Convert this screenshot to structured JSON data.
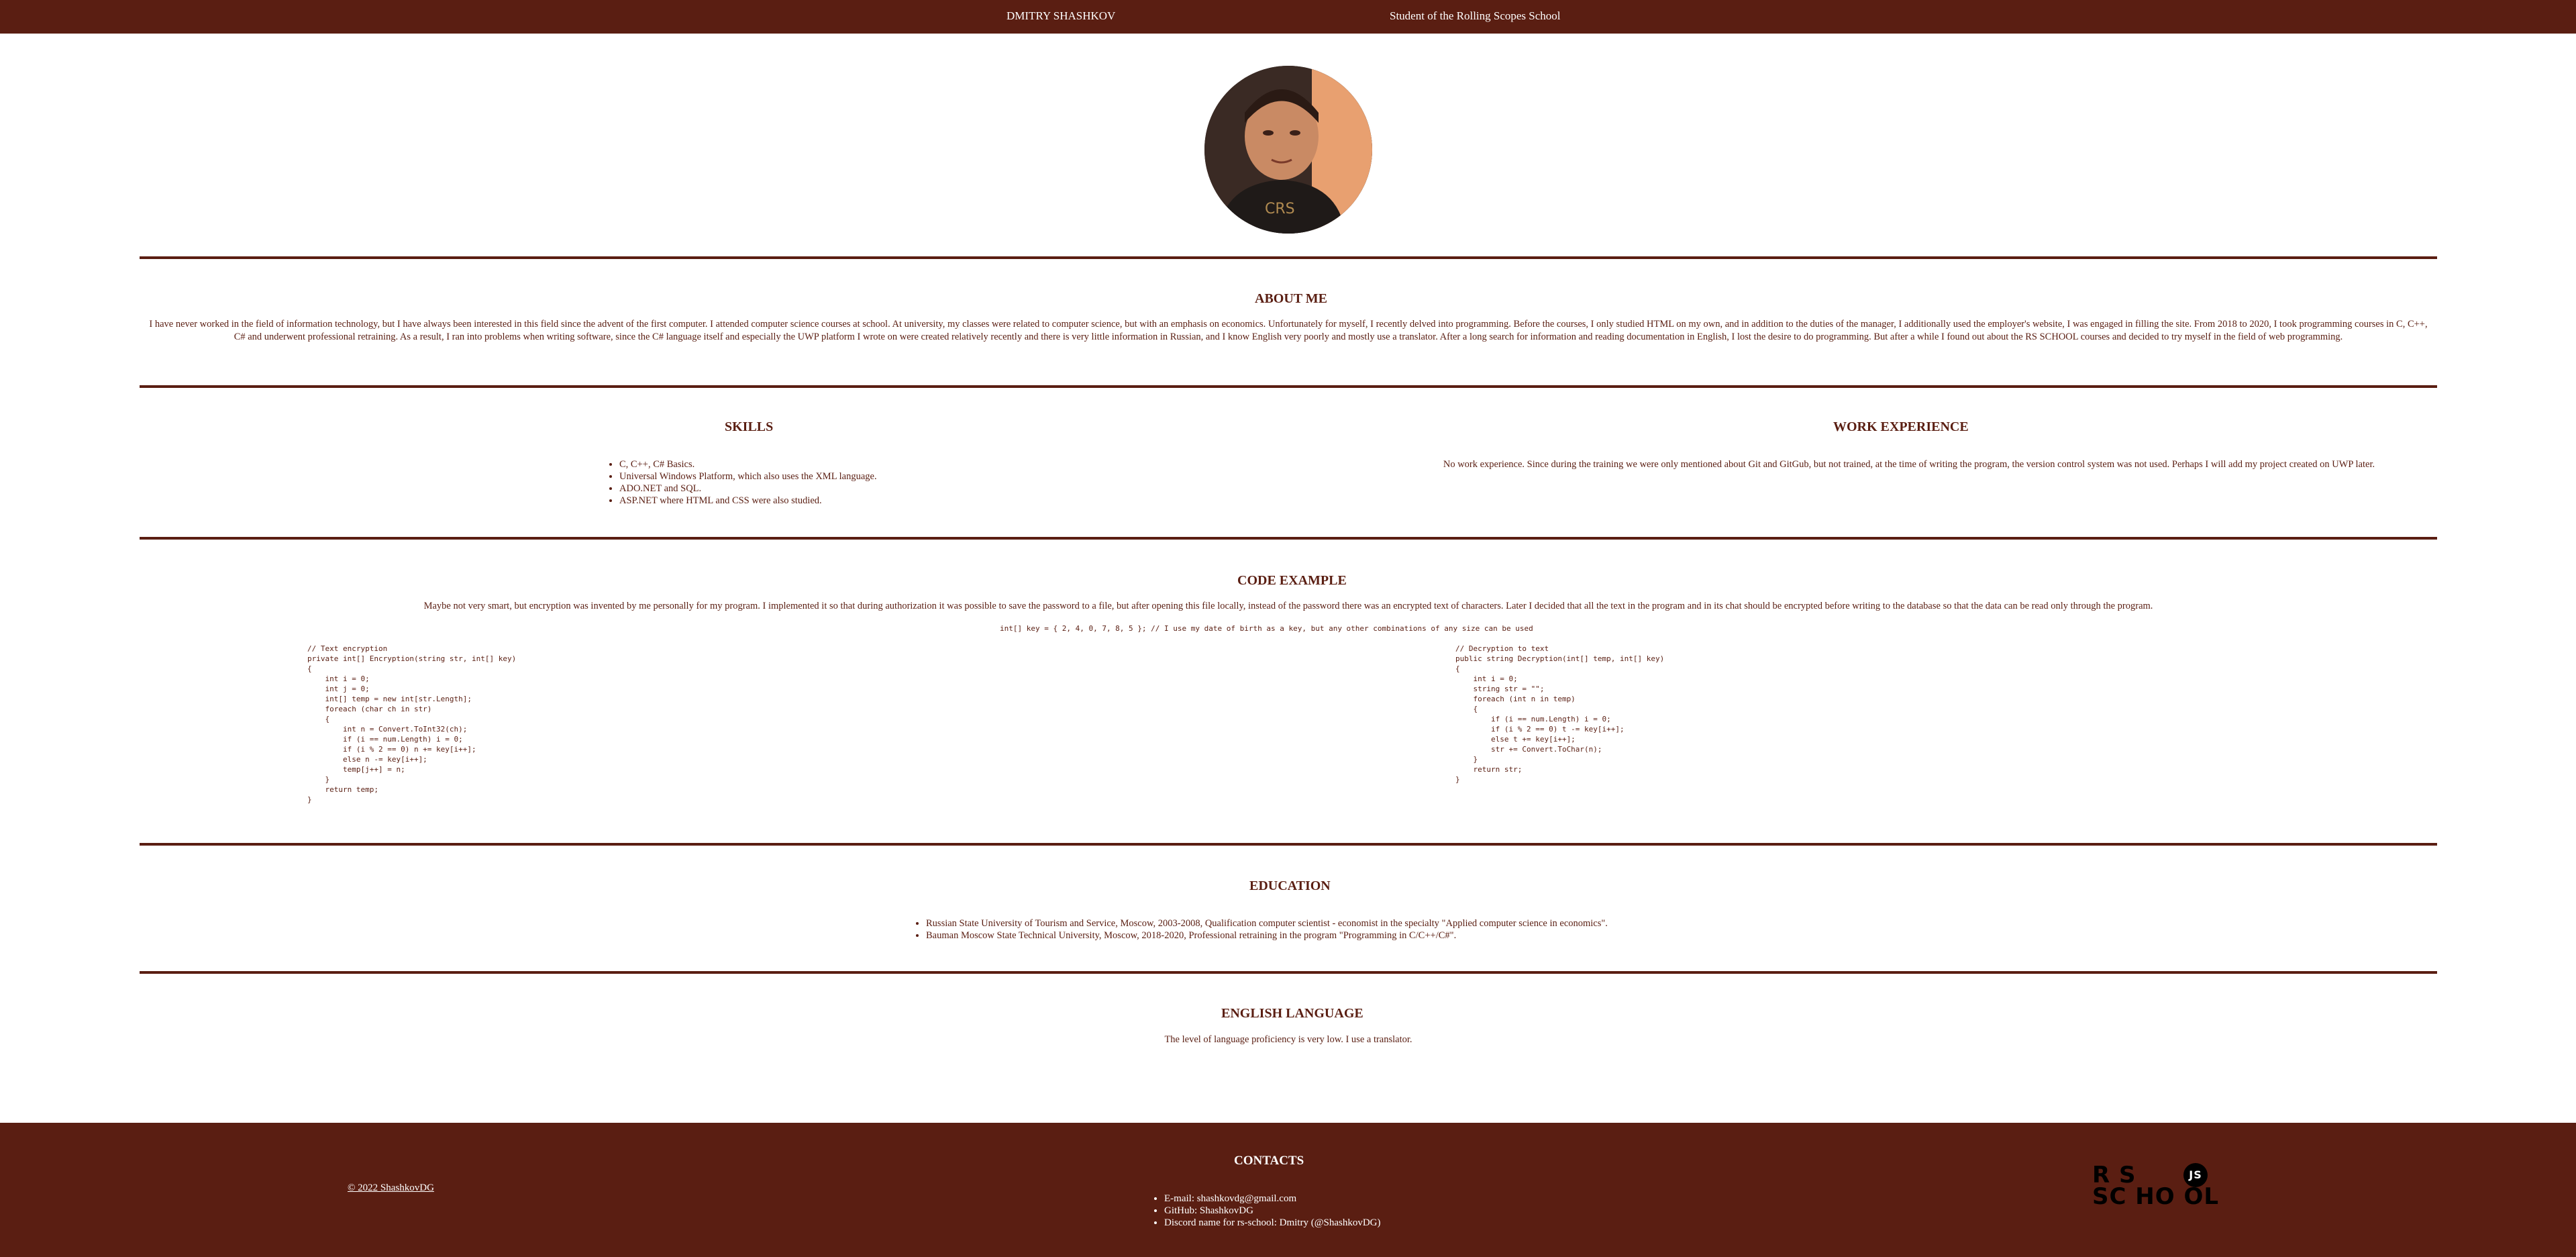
{
  "header": {
    "name": "DMITRY SHASHKOV",
    "subtitle": "Student of the Rolling Scopes School"
  },
  "about": {
    "title": "ABOUT ME",
    "text": "I have never worked in the field of information technology, but I have always been interested in this field since the advent of the first computer. I attended computer science courses at school. At university, my classes were related to computer science, but with an emphasis on economics. Unfortunately for myself, I recently delved into programming. Before the courses, I only studied HTML on my own, and in addition to the duties of the manager, I additionally used the employer's website, I was engaged in filling the site. From 2018 to 2020, I took programming courses in C, C++, C# and underwent professional retraining. As a result, I ran into problems when writing software, since the C# language itself and especially the UWP platform I wrote on were created relatively recently and there is very little information in Russian, and I know English very poorly and mostly use a translator. After a long search for information and reading documentation in English, I lost the desire to do programming. But after a while I found out about the RS SCHOOL courses and decided to try myself in the field of web programming."
  },
  "skills": {
    "title": "SKILLS",
    "items": [
      "C, C++, C# Basics.",
      "Universal Windows Platform, which also uses the XML language.",
      "ADO.NET and SQL.",
      "ASP.NET where HTML and CSS were also studied."
    ]
  },
  "work": {
    "title": "WORK EXPERIENCE",
    "text": "No work experience. Since during the training we were only mentioned about Git and GitGub, but not trained, at the time of writing the program, the version control system was not used. Perhaps I will add my project created on UWP later."
  },
  "code": {
    "title": "CODE EXAMPLE",
    "intro": "Maybe not very smart, but encryption was invented by me personally for my program. I implemented it so that during authorization it was possible to save the password to a file, but after opening this file locally, instead of the password there was an encrypted text of characters. Later I decided that all the text in the program and in its chat should be encrypted before writing to the database so that the data can be read only through the program.",
    "key_line": "int[] key = { 2, 4, 0, 7, 8, 5 }; // I use my date of birth as a key, but any other combinations of any size can be used",
    "encrypt": "// Text encryption\nprivate int[] Encryption(string str, int[] key)\n{\n    int i = 0;\n    int j = 0;\n    int[] temp = new int[str.Length];\n    foreach (char ch in str)\n    {\n        int n = Convert.ToInt32(ch);\n        if (i == num.Length) i = 0;\n        if (i % 2 == 0) n += key[i++];\n        else n -= key[i++];\n        temp[j++] = n;\n    }\n    return temp;\n}",
    "decrypt": "// Decryption to text\npublic string Decryption(int[] temp, int[] key)\n{\n    int i = 0;\n    string str = \"\";\n    foreach (int n in temp)\n    {\n        if (i == num.Length) i = 0;\n        if (i % 2 == 0) t -= key[i++];\n        else t += key[i++];\n        str += Convert.ToChar(n);\n    }\n    return str;\n}"
  },
  "education": {
    "title": "EDUCATION",
    "items": [
      "Russian State University of Tourism and Service, Moscow, 2003-2008, Qualification computer scientist - economist in the specialty \"Applied computer science in economics\".",
      "Bauman Moscow State Technical University, Moscow, 2018-2020, Professional retraining in the program \"Programming in C/C++/C#\"."
    ]
  },
  "english": {
    "title": "ENGLISH LANGUAGE",
    "text": "The level of language proficiency is very low. I use a translator."
  },
  "footer": {
    "copyright": "© 2022 ShashkovDG",
    "contacts_title": "CONTACTS",
    "contacts": [
      "E-mail: shashkovdg@gmail.com",
      "GitHub: ShashkovDG",
      "Discord name for rs-school: Dmitry (@ShashkovDG)"
    ],
    "logo_row1": "R  S",
    "logo_row2": "SC HO OL",
    "logo_badge": "JS"
  },
  "colors": {
    "brand": "#5a1e12",
    "background": "#ffffff"
  }
}
